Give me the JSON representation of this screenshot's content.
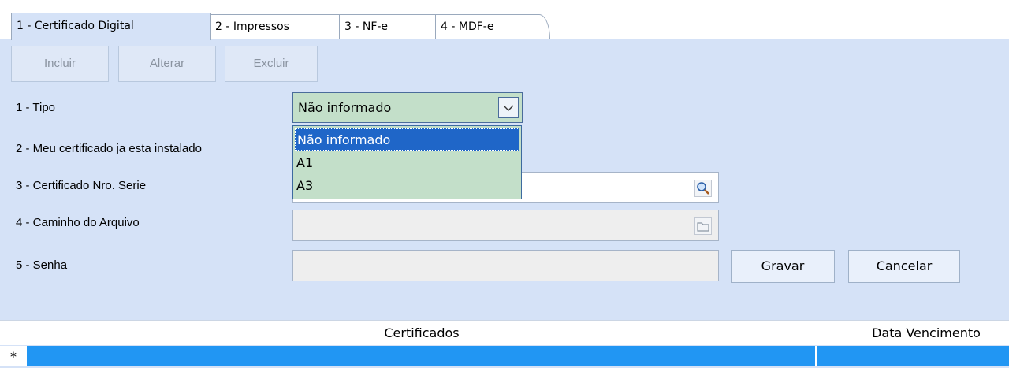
{
  "tabs": [
    {
      "label": "1 - Certificado Digital"
    },
    {
      "label": "2 - Impressos"
    },
    {
      "label": "3 - NF-e"
    },
    {
      "label": "4 - MDF-e"
    }
  ],
  "toolbar": {
    "incluir": "Incluir",
    "alterar": "Alterar",
    "excluir": "Excluir"
  },
  "form": {
    "tipo_label": "1 - Tipo",
    "instalado_label": "2 - Meu certificado ja esta instalado",
    "serie_label": "3 - Certificado Nro. Serie",
    "caminho_label": "4 - Caminho do Arquivo",
    "senha_label": "5 - Senha",
    "tipo_value": "Não informado",
    "tipo_options": [
      "Não informado",
      "A1",
      "A3"
    ]
  },
  "buttons": {
    "gravar": "Gravar",
    "cancelar": "Cancelar"
  },
  "grid": {
    "col_certificados": "Certificados",
    "col_vencimento": "Data Vencimento",
    "new_row_marker": "*"
  },
  "colors": {
    "accent": "#2196f3",
    "combo_bg": "#c3dfc9",
    "panel_bg": "#d5e2f7"
  }
}
